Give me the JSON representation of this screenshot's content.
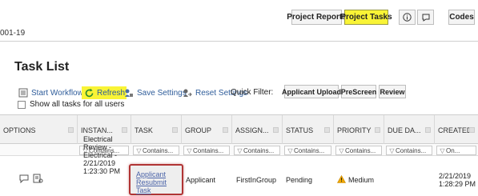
{
  "topbar": {
    "project_reports": "Project Reports",
    "project_tasks": "Project Tasks",
    "codes": "Codes",
    "icon_info": "info-icon",
    "icon_help": "help-icon"
  },
  "project_id": "001-19",
  "page_title": "Task List",
  "toolbar": {
    "start_workflow": "Start Workflow",
    "refresh": "Refresh",
    "save_settings": "Save Settings",
    "reset_settings": "Reset Settings",
    "quick_filter_label": "Quick Filter:",
    "filters": [
      "Applicant Upload",
      "PreScreen",
      "Review"
    ],
    "show_all": "Show all tasks for all users",
    "highlight_color": "#f9f436"
  },
  "grid": {
    "columns": [
      "OPTIONS",
      "INSTAN...",
      "TASK",
      "GROUP",
      "ASSIGN...",
      "STATUS",
      "PRIORITY",
      "DUE DA...",
      "CREATED"
    ],
    "filters": [
      "",
      "Contains...",
      "Contains...",
      "Contains...",
      "Contains...",
      "Contains...",
      "Contains...",
      "Contains...",
      "On..."
    ],
    "rows": [
      {
        "instance": "Electrical Review - Electrical - 2/21/2019 1:23:30 PM",
        "task": "Applicant Resubmit Task",
        "group": "Applicant",
        "assigned": "FirstInGroup",
        "status": "Pending",
        "priority": "Medium",
        "due_date": "",
        "created": "2/21/2019 1:28:29 PM"
      }
    ],
    "highlight_border": "#b03434",
    "warning_color": "#f0a800"
  }
}
